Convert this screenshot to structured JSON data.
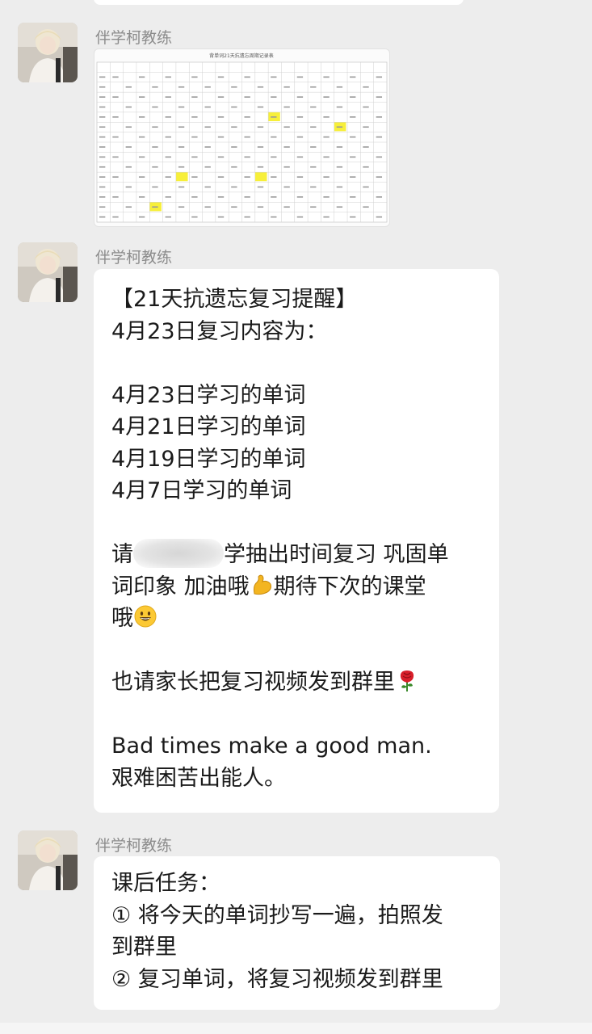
{
  "chat": {
    "messages": [
      {
        "sender": "伴学柯教练",
        "type": "image",
        "image_title": "背单词21天抗遗忘周期记录表"
      },
      {
        "sender": "伴学柯教练",
        "type": "text",
        "lines": [
          "【21天抗遗忘复习提醒】",
          "4月23日复习内容为：",
          "",
          "4月23日学习的单词",
          "4月21日学习的单词",
          "4月19日学习的单词",
          "4月7日学习的单词",
          ""
        ],
        "line_please_start": "请",
        "line_please_end": "学抽出时间复习 巩固单",
        "line_encourage_a": "词印象 加油哦",
        "line_encourage_b": "期待下次的课堂",
        "line_encourage_c": "哦",
        "line_parents": "也请家长把复习视频发到群里",
        "line_en": "Bad times make a good man.",
        "line_zh": "艰难困苦出能人。",
        "emoji_flex": "flexed-biceps-icon",
        "emoji_smile": "grinning-face-icon",
        "emoji_rose": "rose-icon"
      },
      {
        "sender": "伴学柯教练",
        "type": "text",
        "lines": [
          "课后任务：",
          "① 将今天的单词抄写一遍，拍照发",
          "到群里",
          "② 复习单词，将复习视频发到群里"
        ]
      }
    ]
  }
}
